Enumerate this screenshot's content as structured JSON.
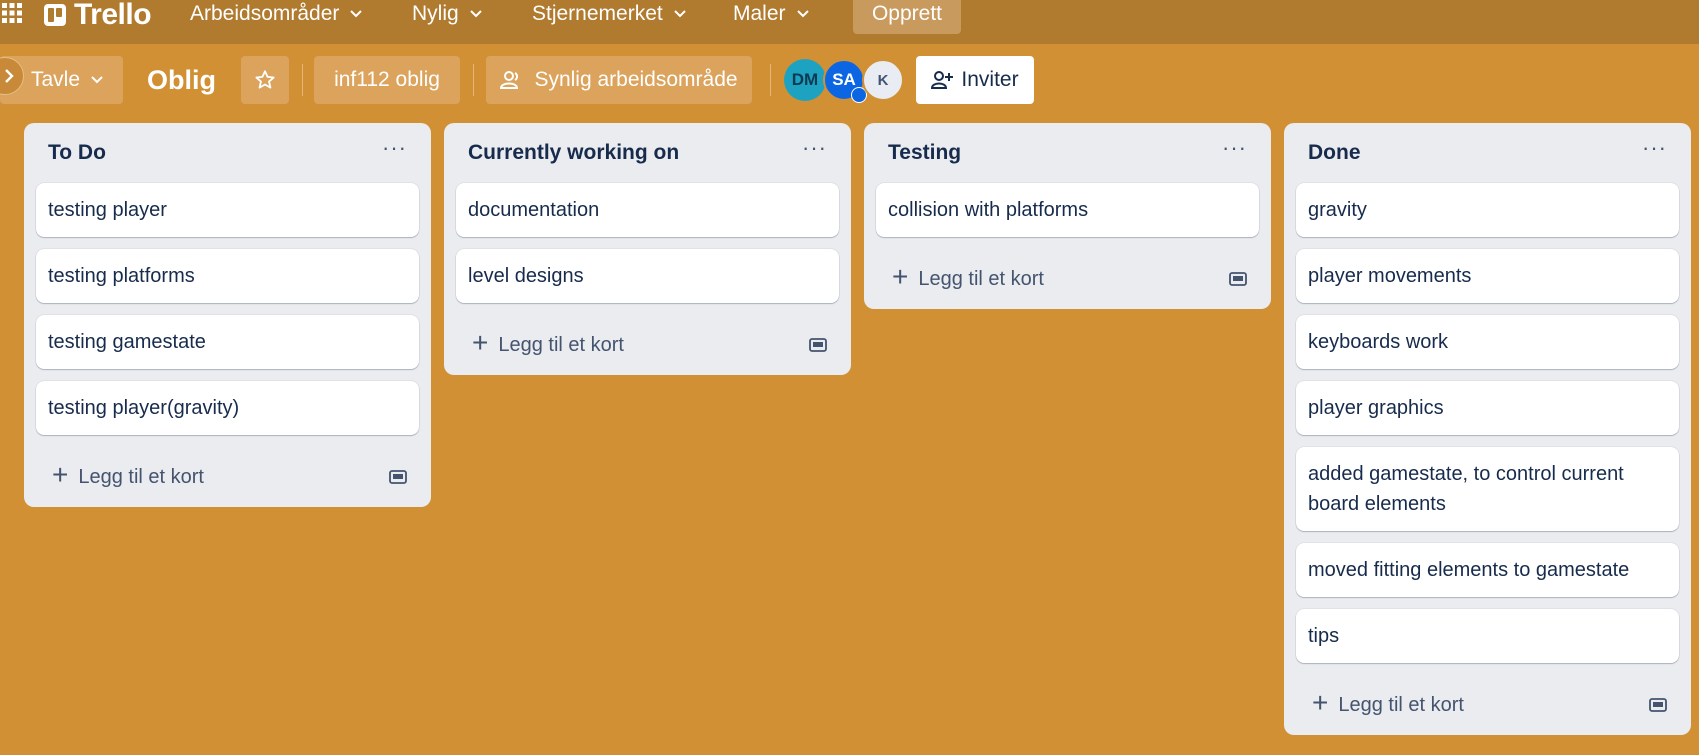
{
  "topnav": {
    "logo": "Trello",
    "items": [
      {
        "label": "Arbeidsområder"
      },
      {
        "label": "Nylig"
      },
      {
        "label": "Stjernemerket"
      },
      {
        "label": "Maler"
      }
    ],
    "create_label": "Opprett"
  },
  "board": {
    "view_label": "Tavle",
    "title": "Oblig",
    "workspace_label": "inf112 oblig",
    "visibility_label": "Synlig arbeidsområde",
    "members": [
      "DM",
      "SA",
      "K"
    ],
    "invite_label": "Inviter"
  },
  "add_card_label": "Legg til et kort",
  "colors": {
    "background": "#d29034",
    "topnav": "#b07a2f",
    "list": "#ebecf0",
    "text": "#172b4d"
  },
  "lists": [
    {
      "title": "To Do",
      "cards": [
        "testing player",
        "testing platforms",
        "testing gamestate",
        "testing player(gravity)"
      ]
    },
    {
      "title": "Currently working on",
      "cards": [
        "documentation",
        "level designs"
      ]
    },
    {
      "title": "Testing",
      "cards": [
        "collision with platforms"
      ]
    },
    {
      "title": "Done",
      "cards": [
        "gravity",
        "player movements",
        "keyboards work",
        "player graphics",
        "added gamestate, to control current board elements",
        "moved fitting elements to gamestate",
        "tips"
      ]
    }
  ]
}
